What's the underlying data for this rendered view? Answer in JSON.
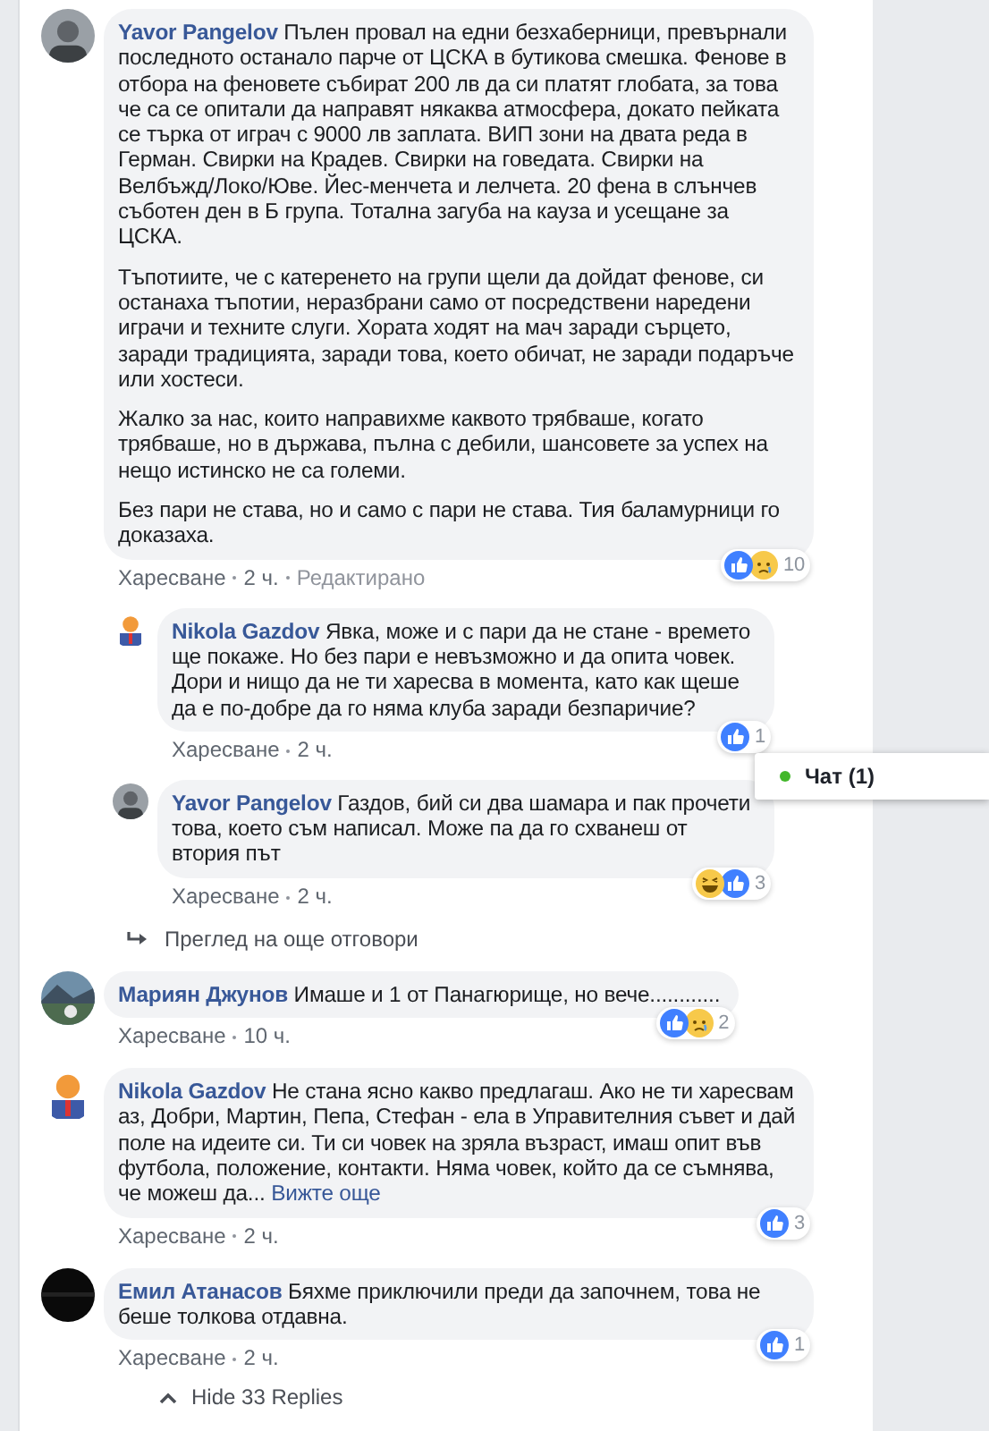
{
  "comments": [
    {
      "author": "Yavor Pangelov",
      "paragraphs": [
        "Пълен провал на едни безхаберници, превърнали последното останало парче от ЦСКА в бутикова смешка. Фенове в отбора на феновете събират 200 лв да си платят глобата, за това че са се опитали да направят някаква атмосфера, докато пейката се търка от играч с 9000 лв заплата. ВИП зони на двата реда в Герман. Свирки на Крадев. Свирки на говедата. Свирки на Велбъжд/Локо/Юве. Йес-менчета и лелчета. 20 фена в слънчев съботен ден в Б група. Тотална загуба на кауза и усещане за ЦСКА.",
        "Тъпотиите, че с катеренето на групи щели да дойдат фенове, си останаха тъпотии, неразбрани само от посредствени наредени играчи и техните слуги. Хората ходят на мач заради сърцето, заради традицията, заради това, което обичат, не заради подаръче или хостеси.",
        "Жалко за нас, които направихме каквото трябваше, когато трябваше, но в държава, пълна с дебили, шансовете за успех на нещо истинско не са големи.",
        "Без пари не става, но и само с пари не става. Тия баламурници го доказаха."
      ],
      "reactions": [
        {
          "kind": "like"
        },
        {
          "kind": "sad"
        }
      ],
      "reaction_count": "10",
      "like_label": "Харесване",
      "time": "2 ч.",
      "edited": "Редактирано",
      "replies": [
        {
          "author": "Nikola Gazdov",
          "paragraphs": [
            "Явка, може и с пари да не стане - времето ще покаже. Но без пари е невъзможно и да опита човек. Дори и нищо да не ти харесва в момента, като как щеше да е по-добре да го няма клуба заради безпаричие?"
          ],
          "reactions": [
            {
              "kind": "like"
            }
          ],
          "reaction_count": "1",
          "like_label": "Харесване",
          "time": "2 ч."
        },
        {
          "author": "Yavor Pangelov",
          "paragraphs": [
            "Газдов, бий си два шамара и пак прочети това, което съм написал. Може па да го схванеш от втория път"
          ],
          "reactions": [
            {
              "kind": "haha"
            },
            {
              "kind": "like"
            }
          ],
          "reaction_count": "3",
          "like_label": "Харесване",
          "time": "2 ч."
        }
      ],
      "more_replies": "Преглед на още отговори"
    },
    {
      "author": "Мариян Джунов",
      "paragraphs": [
        "Имаше и 1 от Панагюрище, но вече............"
      ],
      "reactions": [
        {
          "kind": "like"
        },
        {
          "kind": "sad"
        }
      ],
      "reaction_count": "2",
      "like_label": "Харесване",
      "time": "10 ч."
    },
    {
      "author": "Nikola Gazdov",
      "paragraphs": [
        "Не стана ясно какво предлагаш. Ако не ти харесвам аз, Добри, Мартин, Пепа, Стефан - ела в Управителния съвет и дай поле на идеите си. Ти си човек на зряла възраст, имаш опит във футбола, положение, контакти. Няма човек, който да се съмнява, че можеш да..."
      ],
      "see_more": "Вижте още",
      "reactions": [
        {
          "kind": "like"
        }
      ],
      "reaction_count": "3",
      "like_label": "Харесване",
      "time": "2 ч."
    },
    {
      "author": "Емил Атанасов",
      "paragraphs": [
        "Бяхме приключили преди да започнем, това не беше толкова отдавна."
      ],
      "reactions": [
        {
          "kind": "like"
        }
      ],
      "reaction_count": "1",
      "like_label": "Харесване",
      "time": "2 ч."
    }
  ],
  "hide_replies": "Hide 33 Replies",
  "chat": {
    "label": "Чат (1)",
    "online": true
  }
}
